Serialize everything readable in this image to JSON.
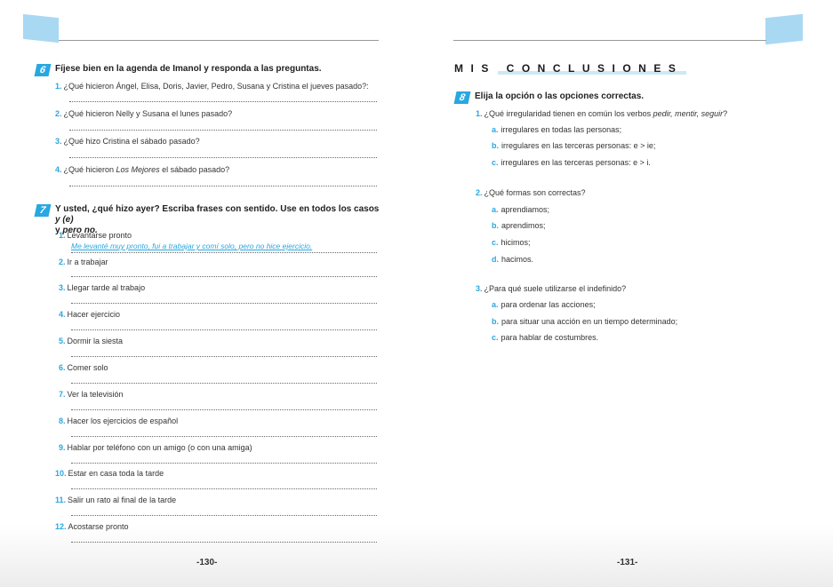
{
  "left": {
    "ex6": {
      "number": "6",
      "title": "Fíjese bien en la agenda de Imanol y responda a las preguntas.",
      "questions": [
        {
          "num": "1.",
          "text": "¿Qué hicieron Ángel, Elisa, Doris, Javier, Pedro, Susana y Cristina el jueves pasado?:"
        },
        {
          "num": "2.",
          "text": "¿Qué hicieron Nelly y Susana el lunes pasado?"
        },
        {
          "num": "3.",
          "text": "¿Qué hizo Cristina el sábado pasado?"
        },
        {
          "num": "4.",
          "pre": "¿Qué hicieron ",
          "italic": "Los Mejores",
          "post": " el sábado pasado?"
        }
      ]
    },
    "ex7": {
      "number": "7",
      "title_line1": "Y usted, ¿qué hizo ayer? Escriba frases con sentido. Use en todos los casos ",
      "title_y_e": "y (e)",
      "title_line2_pre": "y ",
      "title_pero_no": "pero no.",
      "items": [
        {
          "num": "1.",
          "text": "Levantarse pronto"
        },
        {
          "num": "2.",
          "text": "Ir a trabajar"
        },
        {
          "num": "3.",
          "text": "Llegar tarde al trabajo"
        },
        {
          "num": "4.",
          "text": "Hacer ejercicio"
        },
        {
          "num": "5.",
          "text": "Dormir la siesta"
        },
        {
          "num": "6.",
          "text": "Comer solo"
        },
        {
          "num": "7.",
          "text": "Ver la televisión"
        },
        {
          "num": "8.",
          "text": "Hacer los ejercicios de español"
        },
        {
          "num": "9.",
          "text": "Hablar por teléfono con un amigo (o con una amiga)"
        },
        {
          "num": "10.",
          "text": "Estar en casa toda la tarde"
        },
        {
          "num": "11.",
          "text": "Salir un rato al final de la tarde"
        },
        {
          "num": "12.",
          "text": "Acostarse pronto"
        }
      ],
      "example_answer": "Me levanté muy pronto, fui a trabajar y comí solo, pero no hice ejercicio."
    },
    "folio": "-130-"
  },
  "right": {
    "section_title": "MIS CONCLUSIONES",
    "ex8": {
      "number": "8",
      "title": "Elija la opción o las opciones correctas.",
      "q1": {
        "num": "1.",
        "pre": "¿Qué irregularidad tienen en común los verbos ",
        "verbs": "pedir, mentir, seguir",
        "post": "?",
        "options": [
          {
            "letter": "a.",
            "text": "irregulares en todas las personas;"
          },
          {
            "letter": "b.",
            "text": "irregulares en las terceras personas: e > ie;"
          },
          {
            "letter": "c.",
            "text": "irregulares en las terceras personas: e > i."
          }
        ]
      },
      "q2": {
        "num": "2.",
        "text": "¿Qué formas son correctas?",
        "options": [
          {
            "letter": "a.",
            "text": "aprendiamos;"
          },
          {
            "letter": "b.",
            "text": "aprendimos;"
          },
          {
            "letter": "c.",
            "text": "hicimos;"
          },
          {
            "letter": "d.",
            "text": "hacimos."
          }
        ]
      },
      "q3": {
        "num": "3.",
        "text": "¿Para qué suele utilizarse el indefinido?",
        "options": [
          {
            "letter": "a.",
            "text": "para ordenar las acciones;"
          },
          {
            "letter": "b.",
            "text": "para situar una acción en un tiempo determinado;"
          },
          {
            "letter": "c.",
            "text": "para hablar de costumbres."
          }
        ]
      }
    },
    "folio": "-131-"
  },
  "colors": {
    "accent": "#29a7e0",
    "tab": "#a9d8f3",
    "bar": "#cde8f7"
  }
}
